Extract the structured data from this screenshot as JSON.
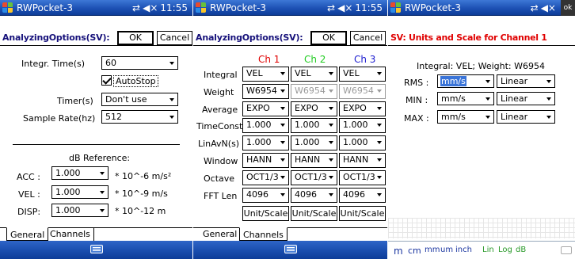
{
  "app_title": "RWPocket-3",
  "status_time": "11:55",
  "status_icons": [
    "connectivity-icon",
    "speaker-icon"
  ],
  "ok_badge": "ok",
  "p1": {
    "header": "AnalyzingOptions(SV):",
    "ok_label": "OK",
    "cancel_label": "Cancel",
    "integr_label": "Integr. Time(s)",
    "integr_value": "60",
    "autostop_label": "AutoStop",
    "timer_label": "Timer(s)",
    "timer_value": "Don't use",
    "sample_label": "Sample Rate(hz)",
    "sample_value": "512",
    "db_title": "dB Reference:",
    "refs": [
      {
        "label": "ACC :",
        "value": "1.000",
        "unit": "* 10^-6 m/s²"
      },
      {
        "label": "VEL :",
        "value": "1.000",
        "unit": "* 10^-9 m/s"
      },
      {
        "label": "DISP:",
        "value": "1.000",
        "unit": "* 10^-12 m"
      }
    ],
    "tabs": [
      "General",
      "Channels"
    ]
  },
  "p2": {
    "header": "AnalyzingOptions(SV):",
    "ok_label": "OK",
    "cancel_label": "Cancel",
    "channels": [
      {
        "name": "Ch 1",
        "color": "#e00000"
      },
      {
        "name": "Ch 2",
        "color": "#22cc22"
      },
      {
        "name": "Ch 3",
        "color": "#2020d0"
      }
    ],
    "rows": [
      {
        "label": "Integral",
        "values": [
          "VEL",
          "VEL",
          "VEL"
        ]
      },
      {
        "label": "Weight",
        "values": [
          "W6954",
          "W6954",
          "W6954"
        ]
      },
      {
        "label": "Average",
        "values": [
          "EXPO",
          "EXPO",
          "EXPO"
        ]
      },
      {
        "label": "TimeConst",
        "values": [
          "1.000",
          "1.000",
          "1.000"
        ]
      },
      {
        "label": "LinAvN(s)",
        "values": [
          "1.000",
          "1.000",
          "1.000"
        ]
      },
      {
        "label": "Window",
        "values": [
          "HANN",
          "HANN",
          "HANN"
        ]
      },
      {
        "label": "Octave",
        "values": [
          "OCT1/3",
          "OCT1/3",
          "OCT1/3"
        ]
      },
      {
        "label": "FFT Len",
        "values": [
          "4096",
          "4096",
          "4096"
        ]
      }
    ],
    "unit_scale_label": "Unit/Scale",
    "tabs": [
      "General",
      "Channels"
    ]
  },
  "p3": {
    "header": "SV: Units and Scale for Channel 1",
    "info": "Integral: VEL;  Weight: W6954",
    "rows": [
      {
        "label": "RMS :",
        "unit": "mm/s",
        "scale": "Linear"
      },
      {
        "label": "MIN :",
        "unit": "mm/s",
        "scale": "Linear"
      },
      {
        "label": "MAX :",
        "unit": "mm/s",
        "scale": "Linear"
      }
    ],
    "bottom_units": [
      "m",
      "cm",
      "mm",
      "um",
      "inch",
      "Lin",
      "Log",
      "dB"
    ]
  }
}
